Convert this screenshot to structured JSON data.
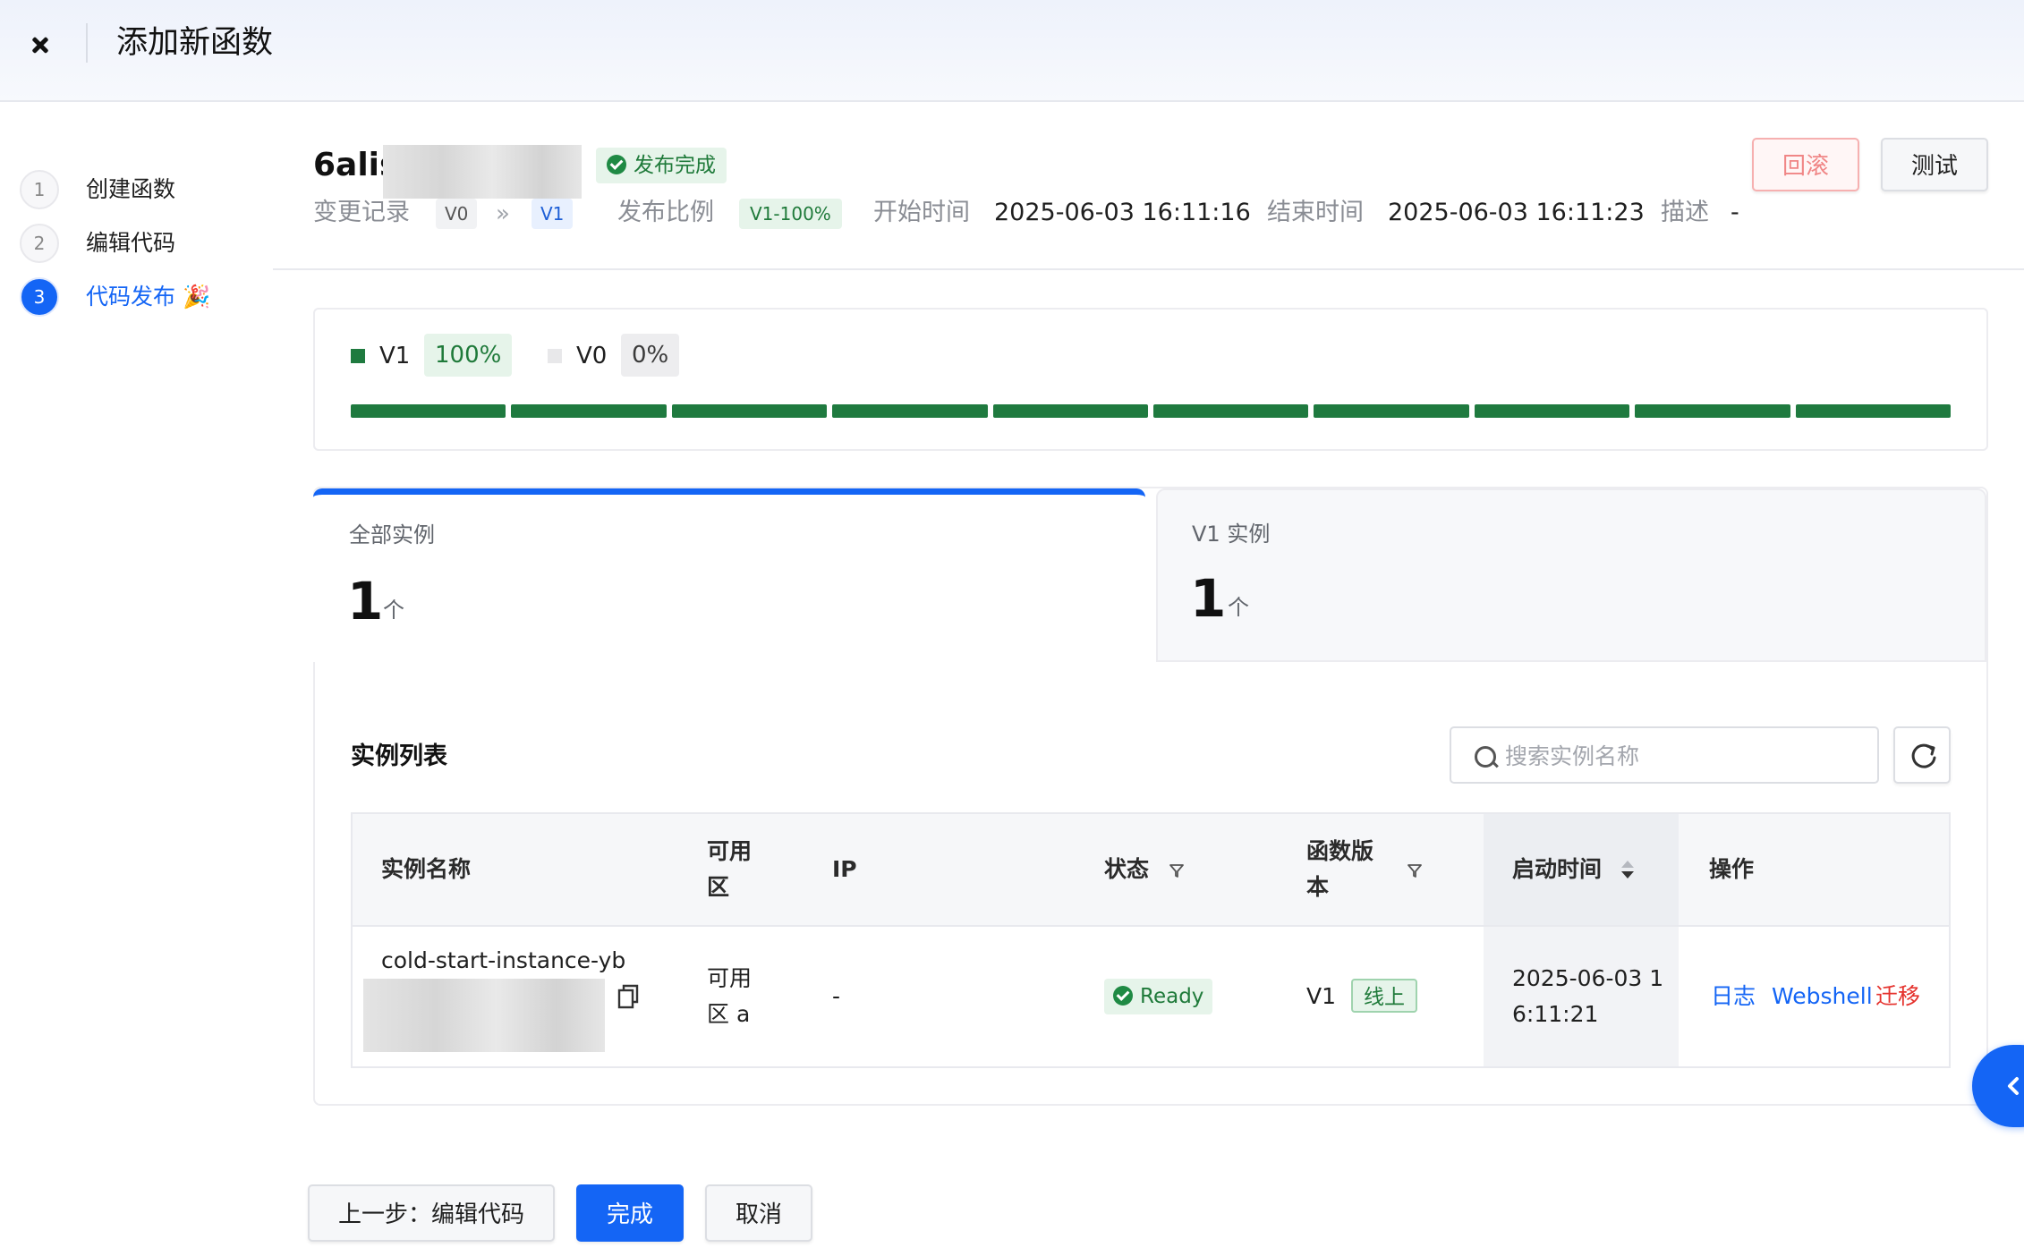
{
  "header": {
    "title": "添加新函数"
  },
  "steps": [
    {
      "number": "1",
      "label": "创建函数"
    },
    {
      "number": "2",
      "label": "编辑代码"
    },
    {
      "number": "3",
      "label": "代码发布 🎉"
    }
  ],
  "function": {
    "name_visible": "6alis",
    "status": "发布完成",
    "change_record_label": "变更记录",
    "from_version": "V0",
    "to_version": "V1",
    "ratio_label": "发布比例",
    "ratio_value": "V1-100%",
    "start_label": "开始时间",
    "start_value": "2025-06-03 16:11:16",
    "end_label": "结束时间",
    "end_value": "2025-06-03 16:11:23",
    "desc_label": "描述",
    "desc_value": "-"
  },
  "actions": {
    "rollback": "回滚",
    "test": "测试"
  },
  "traffic": {
    "v1_label": "V1",
    "v1_percent": "100%",
    "v1_fraction": 1.0,
    "v0_label": "V0",
    "v0_percent": "0%",
    "v0_fraction": 0.0,
    "colors": {
      "v1": "#1f7a3f",
      "v0": "#e8e8ea"
    }
  },
  "tabs": [
    {
      "label": "全部实例",
      "count": "1",
      "unit": "个",
      "active": true
    },
    {
      "label": "V1 实例",
      "count": "1",
      "unit": "个",
      "active": false
    }
  ],
  "instances": {
    "title": "实例列表",
    "search_placeholder": "搜索实例名称",
    "columns": {
      "name": "实例名称",
      "zone_line1": "可用",
      "zone_line2": "区",
      "ip": "IP",
      "status": "状态",
      "version_line1": "函数版",
      "version_line2": "本",
      "start_time": "启动时间",
      "ops": "操作"
    },
    "rows": [
      {
        "name": "cold-start-instance-yb",
        "zone_line1": "可用",
        "zone_line2": "区 a",
        "ip": "-",
        "status": "Ready",
        "version": "V1",
        "version_tag": "线上",
        "time_line1": "2025-06-03 1",
        "time_line2": "6:11:21",
        "op_log": "日志",
        "op_shell": "Webshell",
        "op_migrate": "迁移"
      }
    ]
  },
  "footer": {
    "prev": "上一步：编辑代码",
    "done": "完成",
    "cancel": "取消"
  },
  "colors": {
    "primary": "#1465f5",
    "success": "#1f7a3a",
    "danger": "#e5322d"
  }
}
